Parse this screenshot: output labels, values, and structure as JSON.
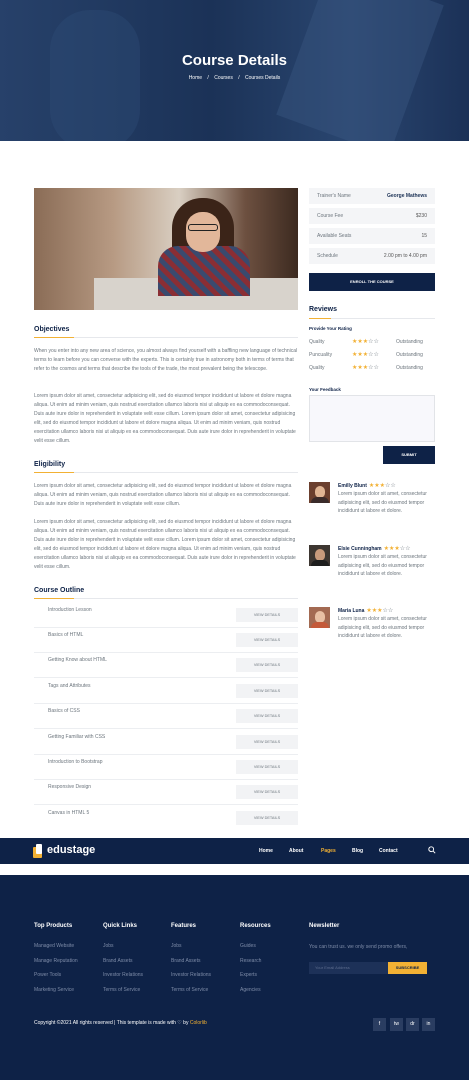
{
  "hero": {
    "title": "Course Details",
    "breadcrumb": [
      "Home",
      "/",
      "Courses",
      "/",
      "Courses Details"
    ]
  },
  "course_info": [
    {
      "label": "Trainer's Name",
      "value": "George Mathews"
    },
    {
      "label": "Course Fee",
      "value": "$230"
    },
    {
      "label": "Available Seats",
      "value": "15"
    },
    {
      "label": "Schedule",
      "value": "2.00 pm to 4.00 pm"
    }
  ],
  "enroll_label": "ENROLL THE COURSE",
  "objectives": {
    "title": "Objectives",
    "p1": "When you enter into any new area of science, you almost always find yourself with a baffling new language of technical terms to learn before you can converse with the experts. This is certainly true in astronomy both in terms of terms that refer to the cosmos and terms that describe the tools of the trade, the most prevalent being the telescope.",
    "p2": "Lorem ipsum dolor sit amet, consectetur adipisicing elit, sed do eiusmod tempor incididunt ut labore et dolore magna aliqua. Ut enim ad minim veniam, quis nostrud exercitation ullamco laboris nisi ut aliquip ex ea commodoconsequat. Duis aute irure dolor in reprehenderit in voluptate velit esse cillum. Lorem ipsum dolor sit amet, consectetur adipisicing elit, sed do eiusmod tempor incididunt ut labore et dolore magna aliqua. Ut enim ad minim veniam, quis nostrud exercitation ullamco laboris nisi ut aliquip ex ea commodoconsequat. Duis aute irure dolor in reprehenderit in voluptate velit esse cillum."
  },
  "eligibility": {
    "title": "Eligibility",
    "p1": "Lorem ipsum dolor sit amet, consectetur adipisicing elit, sed do eiusmod tempor incididunt ut labore et dolore magna aliqua. Ut enim ad minim veniam, quis nostrud exercitation ullamco laboris nisi ut aliquip ex ea commodoconsequat. Duis aute irure dolor in reprehenderit in voluptate velit esse cillum.",
    "p2": "Lorem ipsum dolor sit amet, consectetur adipisicing elit, sed do eiusmod tempor incididunt ut labore et dolore magna aliqua. Ut enim ad minim veniam, quis nostrud exercitation ullamco laboris nisi ut aliquip ex ea commodoconsequat. Duis aute irure dolor in reprehenderit in voluptate velit esse cillum. Lorem ipsum dolor sit amet, consectetur adipisicing elit, sed do eiusmod tempor incididunt ut labore et dolore magna aliqua. Ut enim ad minim veniam, quis nostrud exercitation ullamco laboris nisi ut aliquip ex ea commodoconsequat. Duis aute irure dolor in reprehenderit in voluptate velit esse cillum."
  },
  "outline": {
    "title": "Course Outline",
    "button_label": "VIEW DETAILS",
    "items": [
      "Introduction Lesson",
      "Basics of HTML",
      "Getting Know about HTML",
      "Tags and Attributes",
      "Basics of CSS",
      "Getting Familiar with CSS",
      "Introduction to Bootstrap",
      "Responsive Design",
      "Canvas in HTML 5"
    ]
  },
  "reviews": {
    "title": "Reviews",
    "provide_rating_label": "Provide Your Rating",
    "ratings": [
      {
        "label": "Quality",
        "stars": 3,
        "value": "Outstanding"
      },
      {
        "label": "Puncuality",
        "stars": 3,
        "value": "Outstanding"
      },
      {
        "label": "Quality",
        "stars": 3,
        "value": "Outstanding"
      }
    ],
    "feedback_label": "Your Feedback",
    "submit_label": "SUBMIT",
    "comments": [
      {
        "name": "Emilly Blunt",
        "stars": 3,
        "text": "Lorem ipsum dolor sit amet, consectetur adipisicing elit, sed do eiusmod tempor incididunt ut labore et dolore."
      },
      {
        "name": "Elsie Cunningham",
        "stars": 3,
        "text": "Lorem ipsum dolor sit amet, consectetur adipisicing elit, sed do eiusmod tempor incididunt ut labore et dolore."
      },
      {
        "name": "Maria Luna",
        "stars": 3,
        "text": "Lorem ipsum dolor sit amet, consectetur adipisicing elit, sed do eiusmod tempor incididunt ut labore et dolore."
      }
    ]
  },
  "nav": {
    "brand": "edustage",
    "links": [
      "Home",
      "About",
      "Pages",
      "Blog",
      "Contact"
    ],
    "active": "Pages",
    "search_icon": "search-icon"
  },
  "footer": {
    "columns": [
      {
        "title": "Top Products",
        "links": [
          "Managed Website",
          "Manage Reputation",
          "Power Tools",
          "Marketing Service"
        ]
      },
      {
        "title": "Quick Links",
        "links": [
          "Jobs",
          "Brand Assets",
          "Investor Relations",
          "Terms of Service"
        ]
      },
      {
        "title": "Features",
        "links": [
          "Jobs",
          "Brand Assets",
          "Investor Relations",
          "Terms of Service"
        ]
      },
      {
        "title": "Resources",
        "links": [
          "Guides",
          "Research",
          "Experts",
          "Agencies"
        ]
      }
    ],
    "newsletter": {
      "title": "Newsletter",
      "text": "You can trust us. we only send promo offers,",
      "placeholder": "Your Email Address",
      "button": "SUBSCRIBE"
    },
    "copyright_prefix": "Copyright ©2021 All rights reserved | This template is made with",
    "copyright_by": "by",
    "copyright_brand": "Colorlib",
    "social": [
      "f",
      "tw",
      "dr",
      "in"
    ]
  },
  "colors": {
    "navy": "#0e2247",
    "accent": "#f2b134"
  }
}
